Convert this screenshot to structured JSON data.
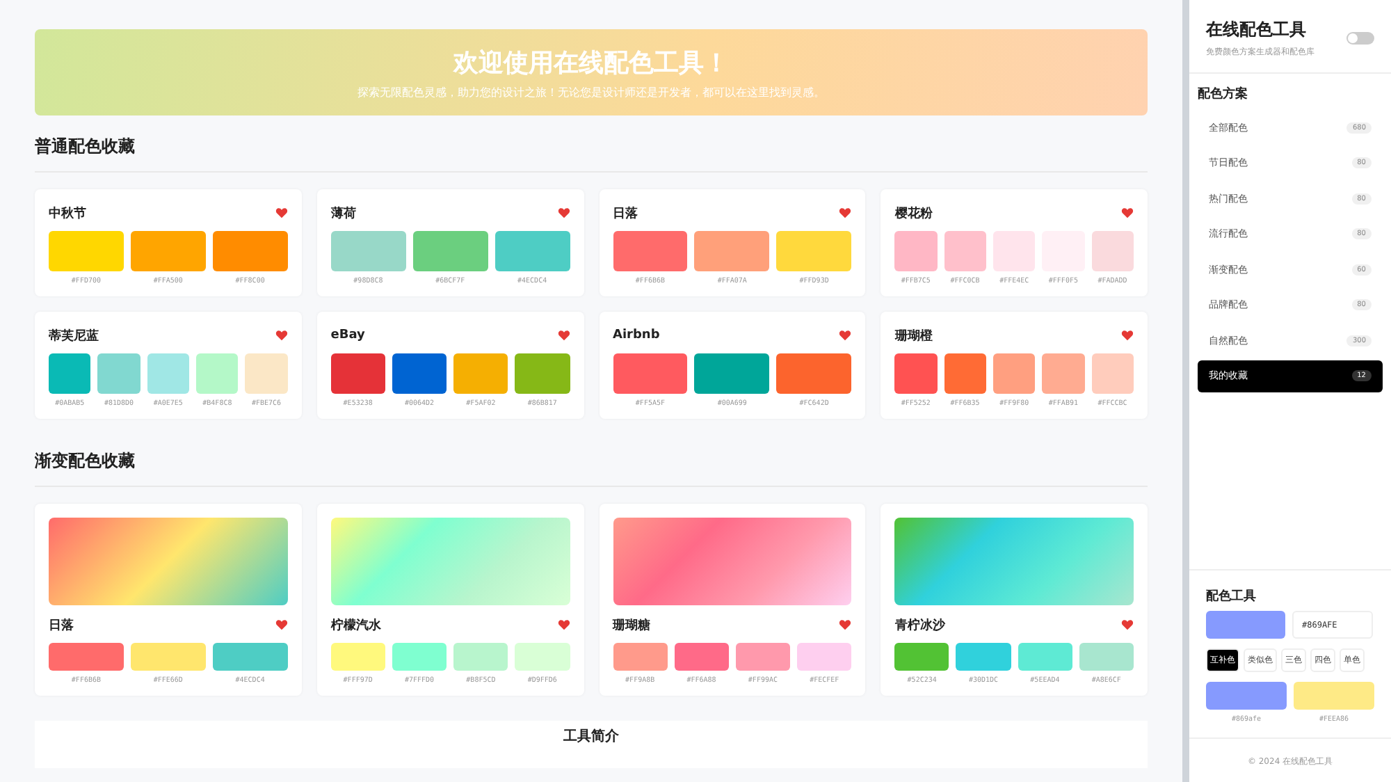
{
  "banner": {
    "title": "欢迎使用在线配色工具！",
    "subtitle": "探索无限配色灵感，助力您的设计之旅！无论您是设计师还是开发者，都可以在这里找到灵感。"
  },
  "sections": [
    {
      "title": "普通配色收藏",
      "kind": "palette",
      "cards": [
        {
          "name": "中秋节",
          "favorite": true,
          "colors": [
            "#FFD700",
            "#FFA500",
            "#FF8C00"
          ]
        },
        {
          "name": "薄荷",
          "favorite": true,
          "colors": [
            "#98D8C8",
            "#6BCF7F",
            "#4ECDC4"
          ]
        },
        {
          "name": "日落",
          "favorite": true,
          "colors": [
            "#FF6B6B",
            "#FFA07A",
            "#FFD93D"
          ]
        },
        {
          "name": "樱花粉",
          "favorite": true,
          "colors": [
            "#FFB7C5",
            "#FFC0CB",
            "#FFE4EC",
            "#FFF0F5",
            "#FADADD"
          ]
        },
        {
          "name": "蒂芙尼蓝",
          "favorite": true,
          "colors": [
            "#0ABAB5",
            "#81D8D0",
            "#A0E7E5",
            "#B4F8C8",
            "#FBE7C6"
          ]
        },
        {
          "name": "eBay",
          "favorite": true,
          "colors": [
            "#E53238",
            "#0064D2",
            "#F5AF02",
            "#86B817"
          ]
        },
        {
          "name": "Airbnb",
          "favorite": true,
          "colors": [
            "#FF5A5F",
            "#00A699",
            "#FC642D"
          ]
        },
        {
          "name": "珊瑚橙",
          "favorite": true,
          "colors": [
            "#FF5252",
            "#FF6B35",
            "#FF9F80",
            "#FFAB91",
            "#FFCCBC"
          ]
        }
      ]
    },
    {
      "title": "渐变配色收藏",
      "kind": "gradient",
      "cards": [
        {
          "name": "日落",
          "favorite": true,
          "colors": [
            "#FF6B6B",
            "#FFE66D",
            "#4ECDC4"
          ]
        },
        {
          "name": "柠檬汽水",
          "favorite": true,
          "colors": [
            "#FFF97D",
            "#7FFFD0",
            "#B8F5CD",
            "#D9FFD6"
          ]
        },
        {
          "name": "珊瑚糖",
          "favorite": true,
          "colors": [
            "#FF9A8B",
            "#FF6A88",
            "#FF99AC",
            "#FECFEF"
          ]
        },
        {
          "name": "青柠冰沙",
          "favorite": true,
          "colors": [
            "#52C234",
            "#30D1DC",
            "#5EEAD4",
            "#A8E6CF"
          ]
        }
      ]
    }
  ],
  "intro": {
    "title": "工具简介"
  },
  "sidebar": {
    "title": "在线配色工具",
    "subtitle": "免费颜色方案生成器和配色库",
    "dark_mode": false,
    "section_title": "配色方案",
    "items": [
      {
        "label": "全部配色",
        "count": "680",
        "selected": false
      },
      {
        "label": "节日配色",
        "count": "80",
        "selected": false
      },
      {
        "label": "热门配色",
        "count": "80",
        "selected": false
      },
      {
        "label": "流行配色",
        "count": "80",
        "selected": false
      },
      {
        "label": "渐变配色",
        "count": "60",
        "selected": false
      },
      {
        "label": "品牌配色",
        "count": "80",
        "selected": false
      },
      {
        "label": "自然配色",
        "count": "300",
        "selected": false
      },
      {
        "label": "我的收藏",
        "count": "12",
        "selected": true
      }
    ],
    "tool": {
      "title": "配色工具",
      "color": "#869AFE",
      "value": "#869AFE",
      "modes": [
        {
          "label": "互补色",
          "selected": true
        },
        {
          "label": "类似色",
          "selected": false
        },
        {
          "label": "三色",
          "selected": false
        },
        {
          "label": "四色",
          "selected": false
        },
        {
          "label": "单色",
          "selected": false
        }
      ],
      "results": [
        {
          "color": "#869AFE",
          "label": "#869afe"
        },
        {
          "color": "#FEEA86",
          "label": "#FEEA86"
        }
      ]
    },
    "footer": "© 2024 在线配色工具"
  }
}
